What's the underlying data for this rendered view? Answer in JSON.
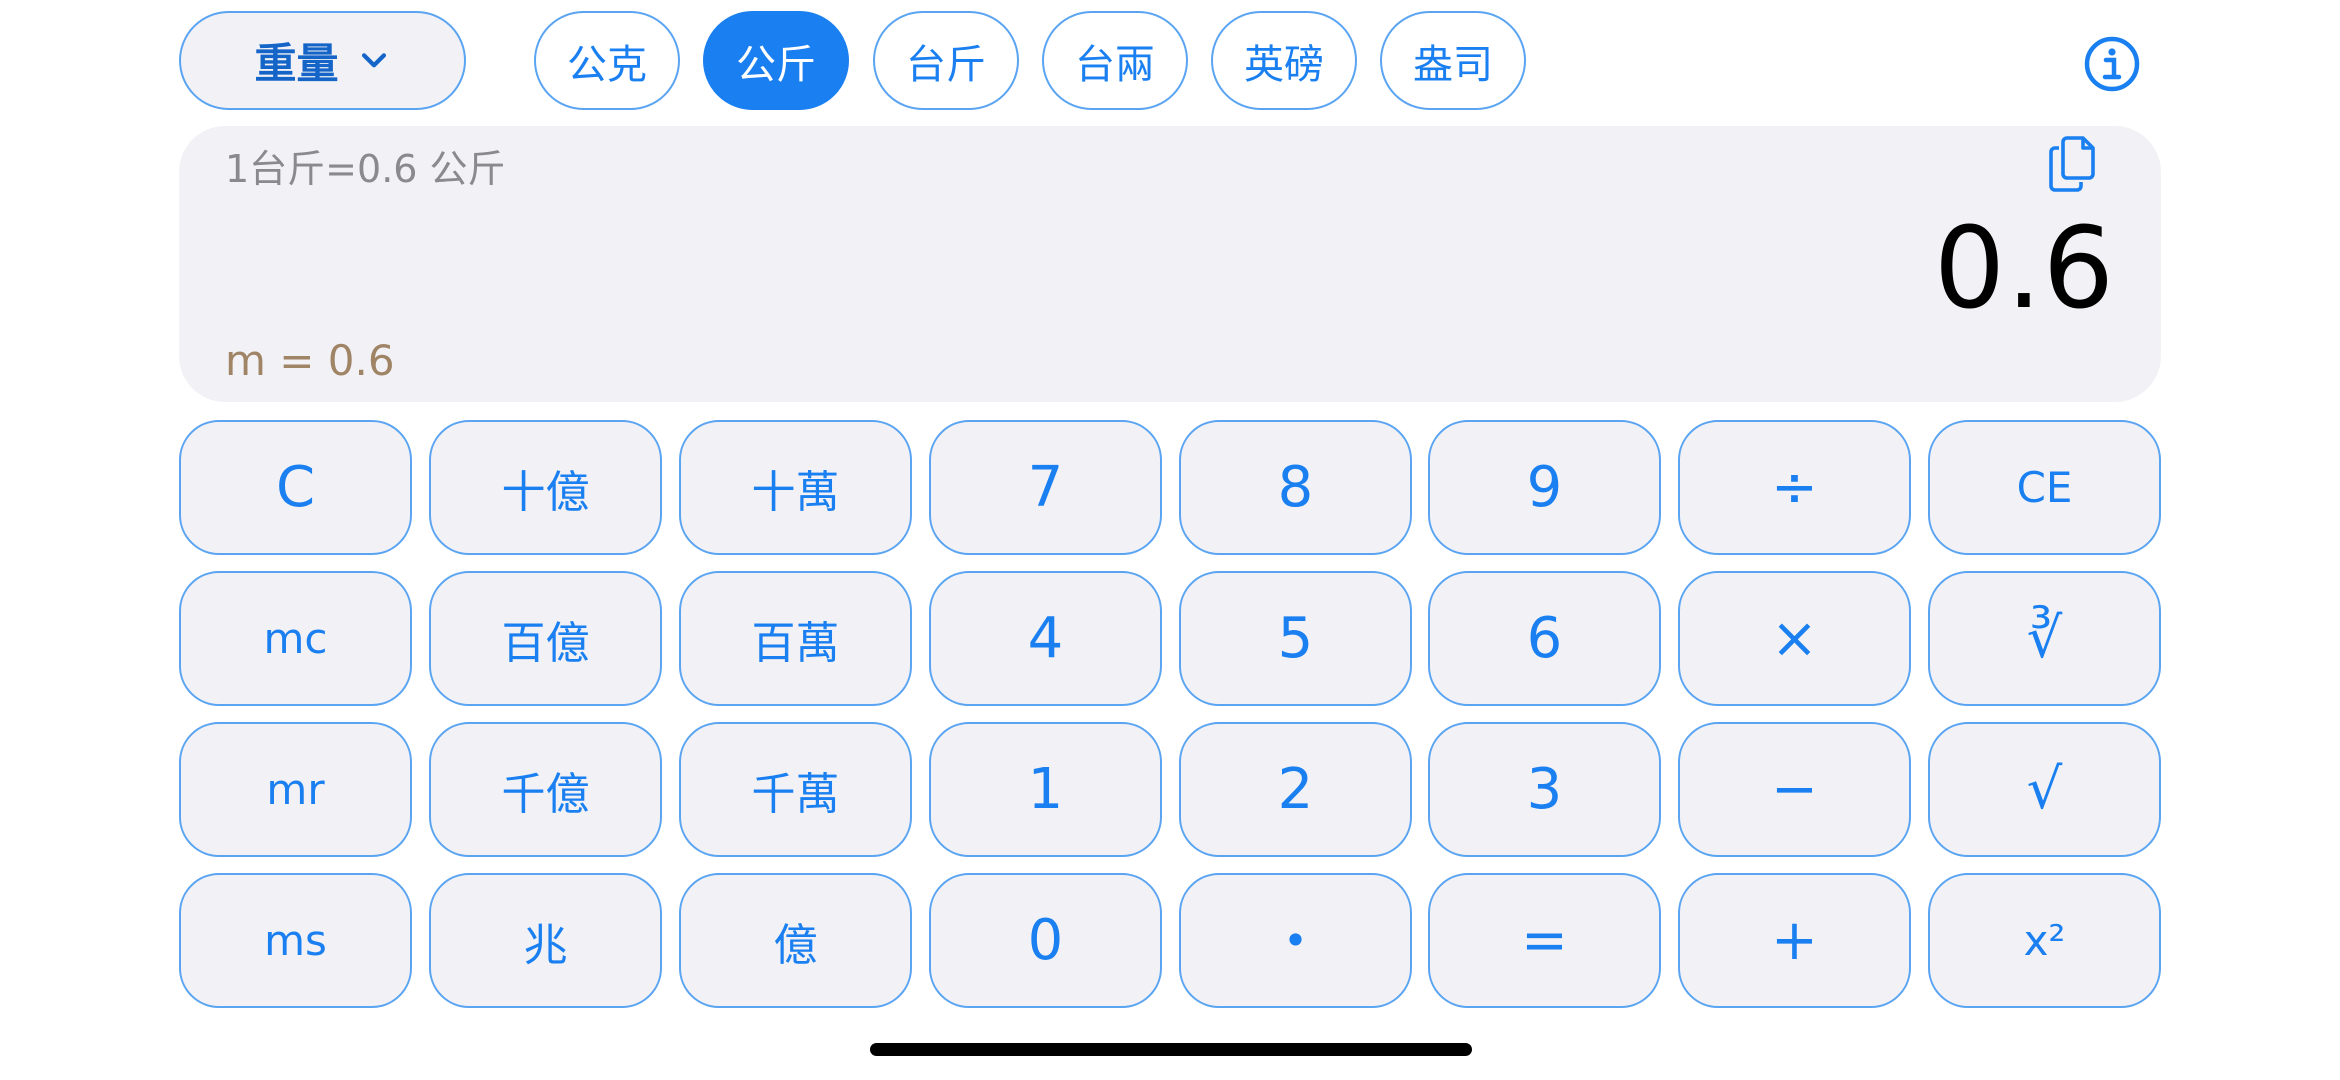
{
  "header": {
    "category_label": "重量",
    "units": [
      "公克",
      "公斤",
      "台斤",
      "台兩",
      "英磅",
      "盎司"
    ],
    "active_unit": "公斤",
    "info_icon": "info-circle-icon"
  },
  "display": {
    "formula": "1台斤=0.6 公斤",
    "result": "0.6",
    "memory": "m = 0.6",
    "copy_icon": "copy-icon"
  },
  "keypad": {
    "rows": [
      [
        "C",
        "十億",
        "十萬",
        "7",
        "8",
        "9",
        "÷",
        "CE"
      ],
      [
        "mc",
        "百億",
        "百萬",
        "4",
        "5",
        "6",
        "×",
        "∛"
      ],
      [
        "mr",
        "千億",
        "千萬",
        "1",
        "2",
        "3",
        "−",
        "√"
      ],
      [
        "ms",
        "兆",
        "億",
        "0",
        "•",
        "=",
        "+",
        "x²"
      ]
    ]
  },
  "colors": {
    "accent": "#1a7ff0",
    "key_border": "#5aa4f2",
    "key_fill": "#f2f2f6",
    "display_fill": "#f1f1f6",
    "memory_text": "#a08466",
    "formula_text": "#8a8a8e"
  }
}
